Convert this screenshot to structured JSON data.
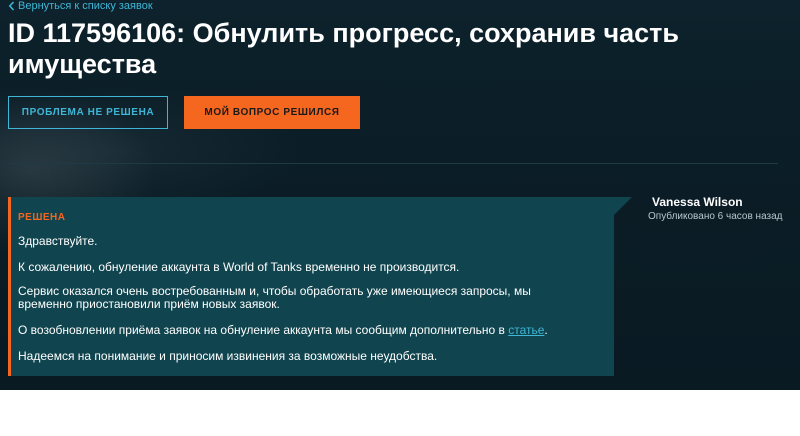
{
  "nav": {
    "back_label": "Вернуться к списку заявок"
  },
  "ticket": {
    "title": "ID 117596106: Обнулить прогресс, сохранив часть имущества"
  },
  "actions": {
    "not_solved_label": "ПРОБЛЕМА НЕ РЕШЕНА",
    "solved_label": "МОЙ ВОПРОС РЕШИЛСЯ"
  },
  "message": {
    "status": "РЕШЕНА",
    "greeting": "Здравствуйте.",
    "p1": "К сожалению, обнуление аккаунта в World of Tanks временно не производится.",
    "p2": "Сервис оказался очень востребованным и, чтобы обработать уже имеющиеся запросы, мы временно приостановили приём новых заявок.",
    "p3_before": "О возобновлении приёма заявок на обнуление аккаунта мы сообщим дополнительно в ",
    "p3_link": "статье",
    "p3_after": ".",
    "p4": "Надеемся на понимание и приносим извинения за возможные неудобства.",
    "author": "Vanessa Wilson",
    "published": "Опубликовано 6 часов назад"
  },
  "colors": {
    "background": "#0b1d26",
    "accent_orange": "#f5661f",
    "accent_cyan": "#3fb6d6",
    "message_bg": "#10444e"
  },
  "icons": {
    "back": "chevron-left-icon"
  }
}
